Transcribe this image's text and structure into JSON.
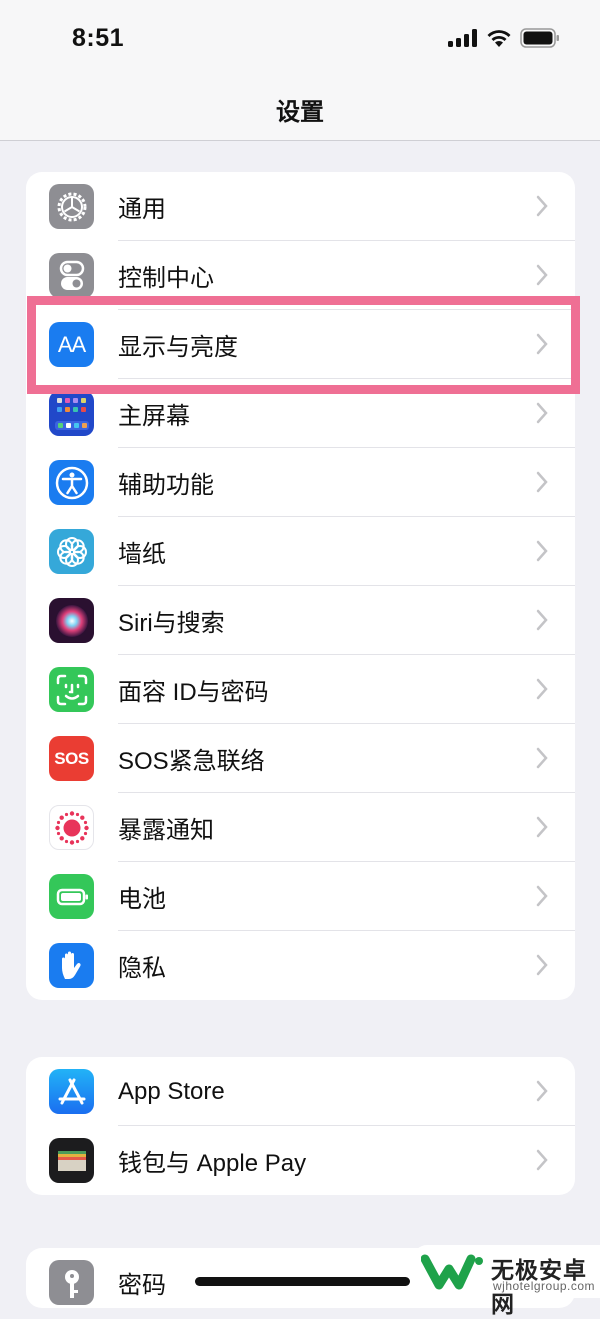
{
  "status_bar": {
    "time": "8:51",
    "signal_icon": "cellular-signal-icon",
    "wifi_icon": "wifi-icon",
    "battery_icon": "battery-full-icon"
  },
  "nav": {
    "title": "设置"
  },
  "groups": [
    {
      "items": [
        {
          "label": "通用",
          "icon": "gear-icon",
          "color": "#8e8e93"
        },
        {
          "label": "控制中心",
          "icon": "toggle-switches-icon",
          "color": "#8e8e93"
        },
        {
          "label": "显示与亮度",
          "icon": "text-size-aa-icon",
          "color": "#1a7cf0",
          "highlighted": true
        },
        {
          "label": "主屏幕",
          "icon": "home-screen-grid-icon",
          "color": "#2148c9"
        },
        {
          "label": "辅助功能",
          "icon": "accessibility-person-icon",
          "color": "#1a7cf0"
        },
        {
          "label": "墙纸",
          "icon": "flower-icon",
          "color": "#35a8d9"
        },
        {
          "label": "Siri与搜索",
          "icon": "siri-orb-icon",
          "color": "#2a1030"
        },
        {
          "label": "面容 ID与密码",
          "icon": "face-id-icon",
          "color": "#34c759"
        },
        {
          "label": "SOS紧急联络",
          "icon": "sos-icon",
          "color": "#ea3d33",
          "icon_text": "SOS"
        },
        {
          "label": "暴露通知",
          "icon": "exposure-dots-icon",
          "color": "#ffffff"
        },
        {
          "label": "电池",
          "icon": "battery-icon",
          "color": "#34c759"
        },
        {
          "label": "隐私",
          "icon": "hand-raised-icon",
          "color": "#1a7cf0"
        }
      ]
    },
    {
      "items": [
        {
          "label": "App Store",
          "icon": "app-store-icon",
          "color": "#1a8cf5"
        },
        {
          "label": "钱包与 Apple Pay",
          "icon": "wallet-icon",
          "color": "#1c1c1e"
        }
      ]
    },
    {
      "items": [
        {
          "label": "密码",
          "icon": "key-icon",
          "color": "#8e8e93"
        }
      ]
    }
  ],
  "watermark": {
    "title": "无极安卓网",
    "url": "wjhotelgroup.com",
    "accent": "#1fa24a"
  },
  "highlight_color": "#ef6f94"
}
